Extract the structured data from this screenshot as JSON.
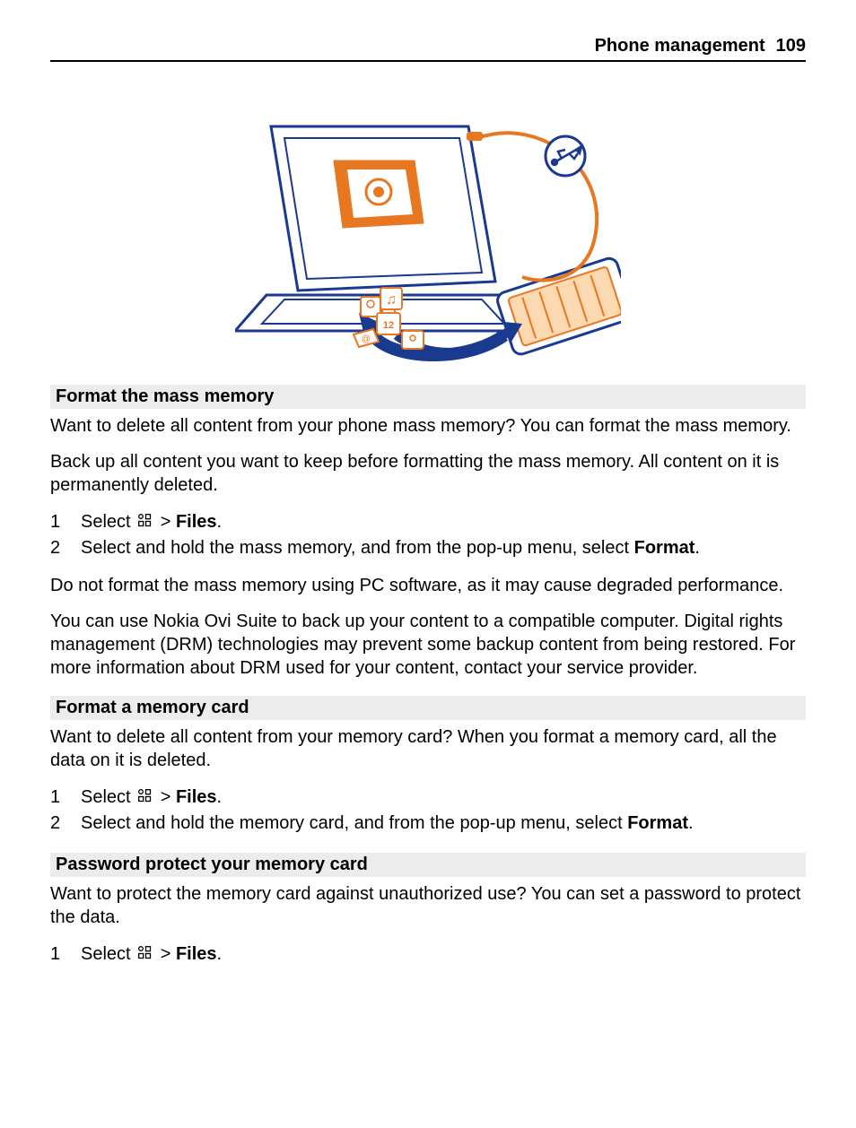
{
  "header": {
    "title": "Phone management",
    "page": "109"
  },
  "section1": {
    "title": "Format the mass memory",
    "p1": "Want to delete all content from your phone mass memory? You can format the mass memory.",
    "p2": "Back up all content you want to keep before formatting the mass memory. All content on it is permanently deleted.",
    "step1_pre": "Select ",
    "step1_sep": " > ",
    "step1_bold": "Files",
    "step1_post": ".",
    "step2_a": "Select and hold the mass memory, and from the pop-up menu, select ",
    "step2_bold": "Format",
    "step2_post": ".",
    "p3": "Do not format the mass memory using PC software, as it may cause degraded performance.",
    "p4": "You can use Nokia Ovi Suite to back up your content to a compatible computer. Digital rights management (DRM) technologies may prevent some backup content from being restored. For more information about DRM used for your content, contact your service provider."
  },
  "section2": {
    "title": "Format a memory card",
    "p1": "Want to delete all content from your memory card? When you format a memory card, all the data on it is deleted.",
    "step1_pre": "Select ",
    "step1_sep": " > ",
    "step1_bold": "Files",
    "step1_post": ".",
    "step2_a": "Select and hold the memory card, and from the pop-up menu, select ",
    "step2_bold": "Format",
    "step2_post": "."
  },
  "section3": {
    "title": "Password protect your memory card",
    "p1": "Want to protect the memory card against unauthorized use? You can set a password to protect the data.",
    "step1_pre": "Select ",
    "step1_sep": " > ",
    "step1_bold": "Files",
    "step1_post": "."
  },
  "nums": {
    "n1": "1",
    "n2": "2"
  }
}
